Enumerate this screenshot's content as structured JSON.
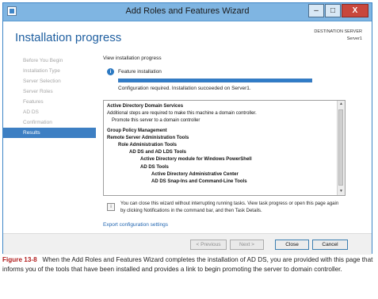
{
  "window": {
    "title": "Add Roles and Features Wizard",
    "controls": {
      "minimize": "–",
      "maximize": "□",
      "close": "X"
    }
  },
  "header": {
    "page_title": "Installation progress",
    "destination_label": "DESTINATION SERVER",
    "destination_value": "Server1"
  },
  "sidebar": {
    "items": [
      {
        "label": "Before You Begin",
        "active": false
      },
      {
        "label": "Installation Type",
        "active": false
      },
      {
        "label": "Server Selection",
        "active": false
      },
      {
        "label": "Server Roles",
        "active": false
      },
      {
        "label": "Features",
        "active": false
      },
      {
        "label": "AD DS",
        "active": false
      },
      {
        "label": "Confirmation",
        "active": false
      },
      {
        "label": "Results",
        "active": true
      }
    ]
  },
  "main": {
    "section_title": "View installation progress",
    "feature_installation": "Feature installation",
    "info_icon": "i",
    "progress_fraction": 1.0,
    "status_text": "Configuration required. Installation succeeded on Server1.",
    "results": [
      "Active Directory Domain Services",
      "Additional steps are required to make this machine a domain controller.",
      "Promote this server to a domain controller",
      "Group Policy Management",
      "Remote Server Administration Tools",
      "Role Administration Tools",
      "AD DS and AD LDS Tools",
      "Active Directory module for Windows PowerShell",
      "AD DS Tools",
      "Active Directory Administrative Center",
      "AD DS Snap-Ins and Command-Line Tools"
    ],
    "scroll_up": "▲",
    "scroll_down": "▼",
    "note_icon": "i",
    "note_text": "You can close this wizard without interrupting running tasks. View task progress or open this page again by clicking Notifications in the command bar, and then Task Details.",
    "export_link": "Export configuration settings"
  },
  "footer": {
    "previous": "< Previous",
    "next": "Next >",
    "close": "Close",
    "cancel": "Cancel"
  },
  "caption": {
    "figure_label": "Figure 13-8",
    "text": "When the Add Roles and Features Wizard completes the installation of AD DS, you are provided with this page that informs you of the tools that have been installed and provides a link to begin promoting the server to domain controller."
  },
  "colors": {
    "accent": "#3d7fc3",
    "title_bar": "#7fb5e2",
    "close_button": "#c9473c",
    "caption_label": "#b11d1d"
  }
}
